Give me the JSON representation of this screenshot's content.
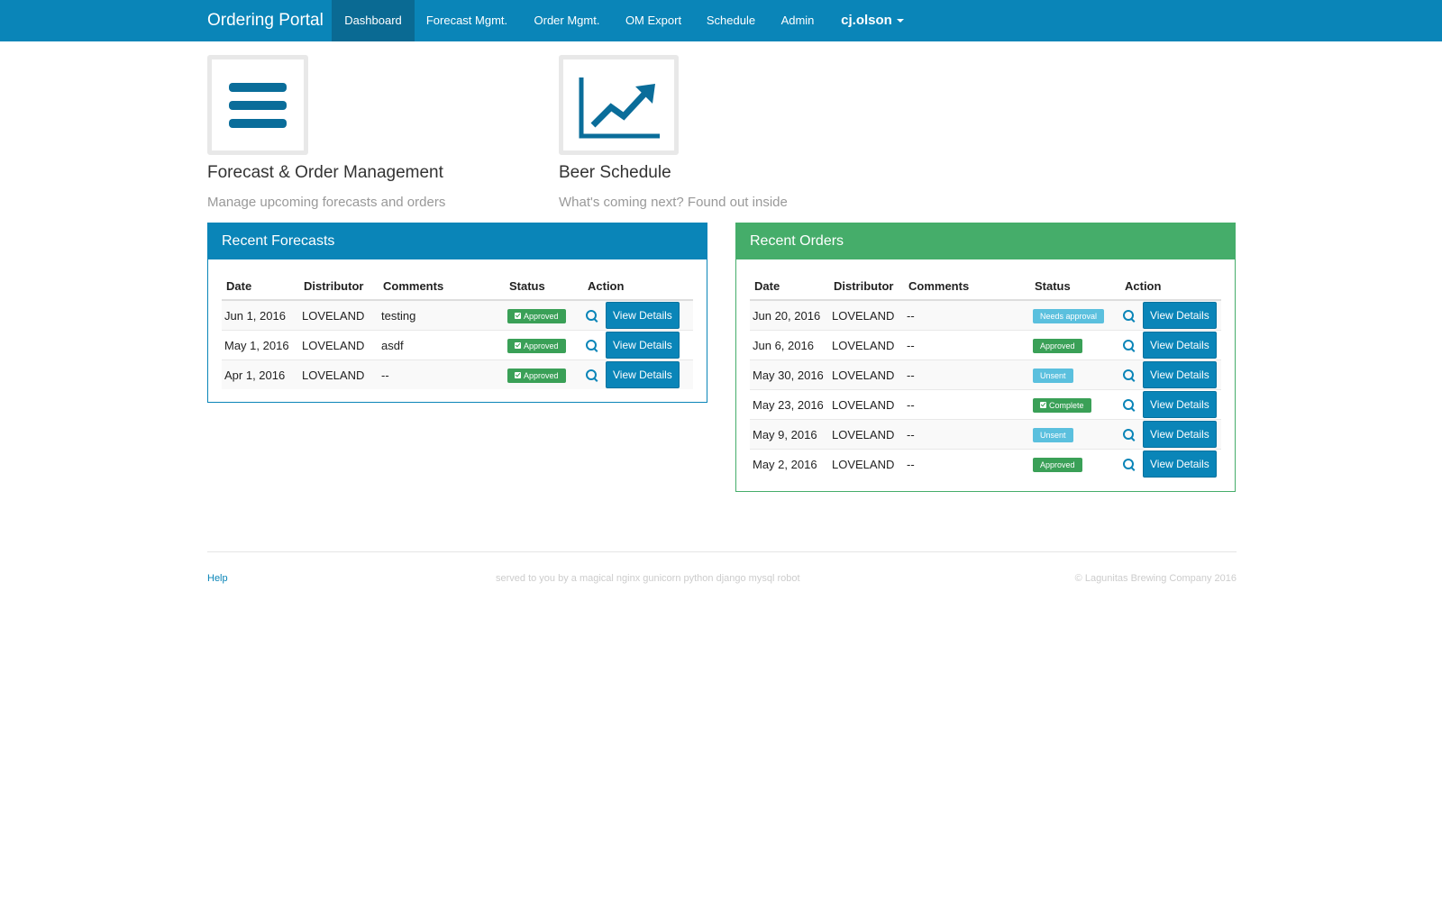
{
  "navbar": {
    "brand": "Ordering Portal",
    "items": [
      "Dashboard",
      "Forecast Mgmt.",
      "Order Mgmt.",
      "OM Export",
      "Schedule",
      "Admin"
    ],
    "user": "cj.olson"
  },
  "tiles": [
    {
      "title": "Forecast & Order Management",
      "description": "Manage upcoming forecasts and orders",
      "icon": "menu-icon"
    },
    {
      "title": "Beer Schedule",
      "description": "What's coming next? Found out inside",
      "icon": "chart-line-icon"
    }
  ],
  "forecasts": {
    "title": "Recent Forecasts",
    "columns": [
      "Date",
      "Distributor",
      "Comments",
      "Status",
      "Action"
    ],
    "rows": [
      {
        "date": "Jun 1, 2016",
        "distributor": "LOVELAND",
        "comments": "testing",
        "status": "Approved",
        "action": "View Details"
      },
      {
        "date": "May 1, 2016",
        "distributor": "LOVELAND",
        "comments": "asdf",
        "status": "Approved",
        "action": "View Details"
      },
      {
        "date": "Apr 1, 2016",
        "distributor": "LOVELAND",
        "comments": "--",
        "status": "Approved",
        "action": "View Details"
      }
    ]
  },
  "orders": {
    "title": "Recent Orders",
    "columns": [
      "Date",
      "Distributor",
      "Comments",
      "Status",
      "Action"
    ],
    "rows": [
      {
        "date": "Jun 20, 2016",
        "distributor": "LOVELAND",
        "comments": "--",
        "status": "Needs approval",
        "action": "View Details"
      },
      {
        "date": "Jun 6, 2016",
        "distributor": "LOVELAND",
        "comments": "--",
        "status": "Approved",
        "action": "View Details"
      },
      {
        "date": "May 30, 2016",
        "distributor": "LOVELAND",
        "comments": "--",
        "status": "Unsent",
        "action": "View Details"
      },
      {
        "date": "May 23, 2016",
        "distributor": "LOVELAND",
        "comments": "--",
        "status": "Complete",
        "action": "View Details"
      },
      {
        "date": "May 9, 2016",
        "distributor": "LOVELAND",
        "comments": "--",
        "status": "Unsent",
        "action": "View Details"
      },
      {
        "date": "May 2, 2016",
        "distributor": "LOVELAND",
        "comments": "--",
        "status": "Approved",
        "action": "View Details"
      }
    ]
  },
  "footer": {
    "help": "Help",
    "middle": "served to you by a magical nginx gunicorn python django mysql robot",
    "copyright": "© Lagunitas Brewing Company 2016"
  },
  "colors": {
    "primary": "#0a85b8",
    "success": "#45ad6a",
    "info": "#5bc0de"
  }
}
